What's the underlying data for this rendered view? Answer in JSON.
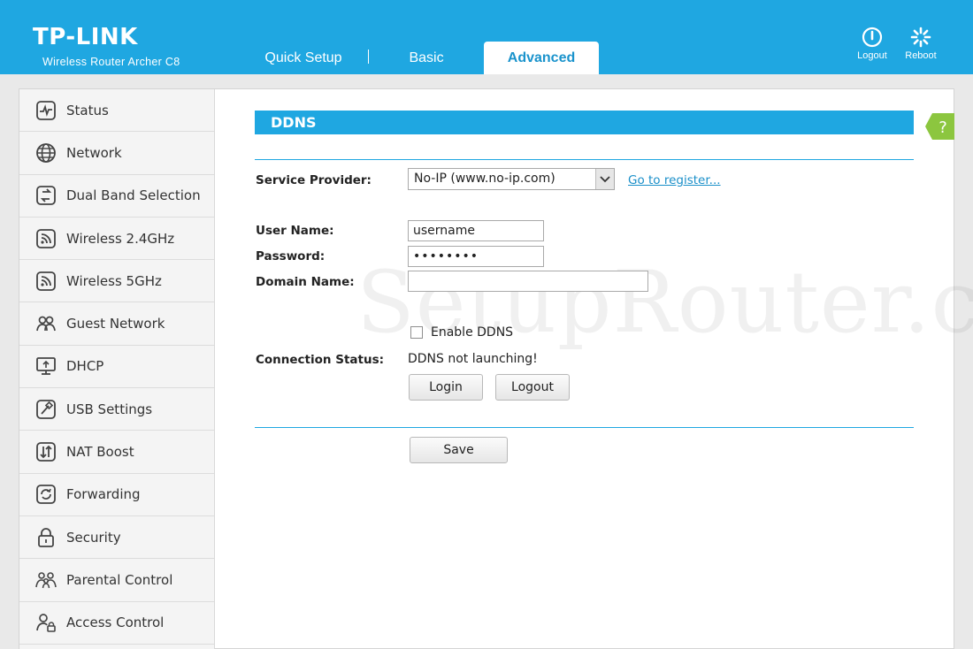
{
  "header": {
    "logo": "TP-LINK",
    "model": "Wireless Router Archer C8",
    "tabs": [
      {
        "label": "Quick Setup"
      },
      {
        "label": "Basic"
      },
      {
        "label": "Advanced"
      }
    ],
    "active_tab": "Advanced",
    "logout_label": "Logout",
    "reboot_label": "Reboot",
    "logout_icon": "power-icon",
    "reboot_icon": "spinner-icon"
  },
  "sidebar": {
    "items": [
      {
        "label": "Status",
        "icon": "pulse-icon"
      },
      {
        "label": "Network",
        "icon": "globe-icon"
      },
      {
        "label": "Dual Band Selection",
        "icon": "swap-icon"
      },
      {
        "label": "Wireless 2.4GHz",
        "icon": "wifi-icon"
      },
      {
        "label": "Wireless 5GHz",
        "icon": "wifi-icon"
      },
      {
        "label": "Guest Network",
        "icon": "guests-icon"
      },
      {
        "label": "DHCP",
        "icon": "monitor-icon"
      },
      {
        "label": "USB Settings",
        "icon": "usb-icon"
      },
      {
        "label": "NAT Boost",
        "icon": "updown-icon"
      },
      {
        "label": "Forwarding",
        "icon": "forward-icon"
      },
      {
        "label": "Security",
        "icon": "lock-icon"
      },
      {
        "label": "Parental Control",
        "icon": "family-icon"
      },
      {
        "label": "Access Control",
        "icon": "user-lock-icon"
      }
    ]
  },
  "main": {
    "section_title": "DDNS",
    "help_label": "?",
    "service_provider_label": "Service Provider:",
    "service_provider_value": "No-IP (www.no-ip.com)",
    "register_link": "Go to register...",
    "username_label": "User Name:",
    "username_value": "username",
    "password_label": "Password:",
    "password_value": "••••••••",
    "domain_label": "Domain Name:",
    "domain_value": "",
    "enable_ddns_label": "Enable DDNS",
    "enable_ddns_checked": false,
    "connection_status_label": "Connection Status:",
    "connection_status_value": "DDNS not launching!",
    "login_button": "Login",
    "logout_button": "Logout",
    "save_button": "Save"
  },
  "watermark": "SetupRouter.com",
  "colors": {
    "accent": "#1fa7e1",
    "link": "#1a8fc9",
    "help": "#8cc63f"
  }
}
